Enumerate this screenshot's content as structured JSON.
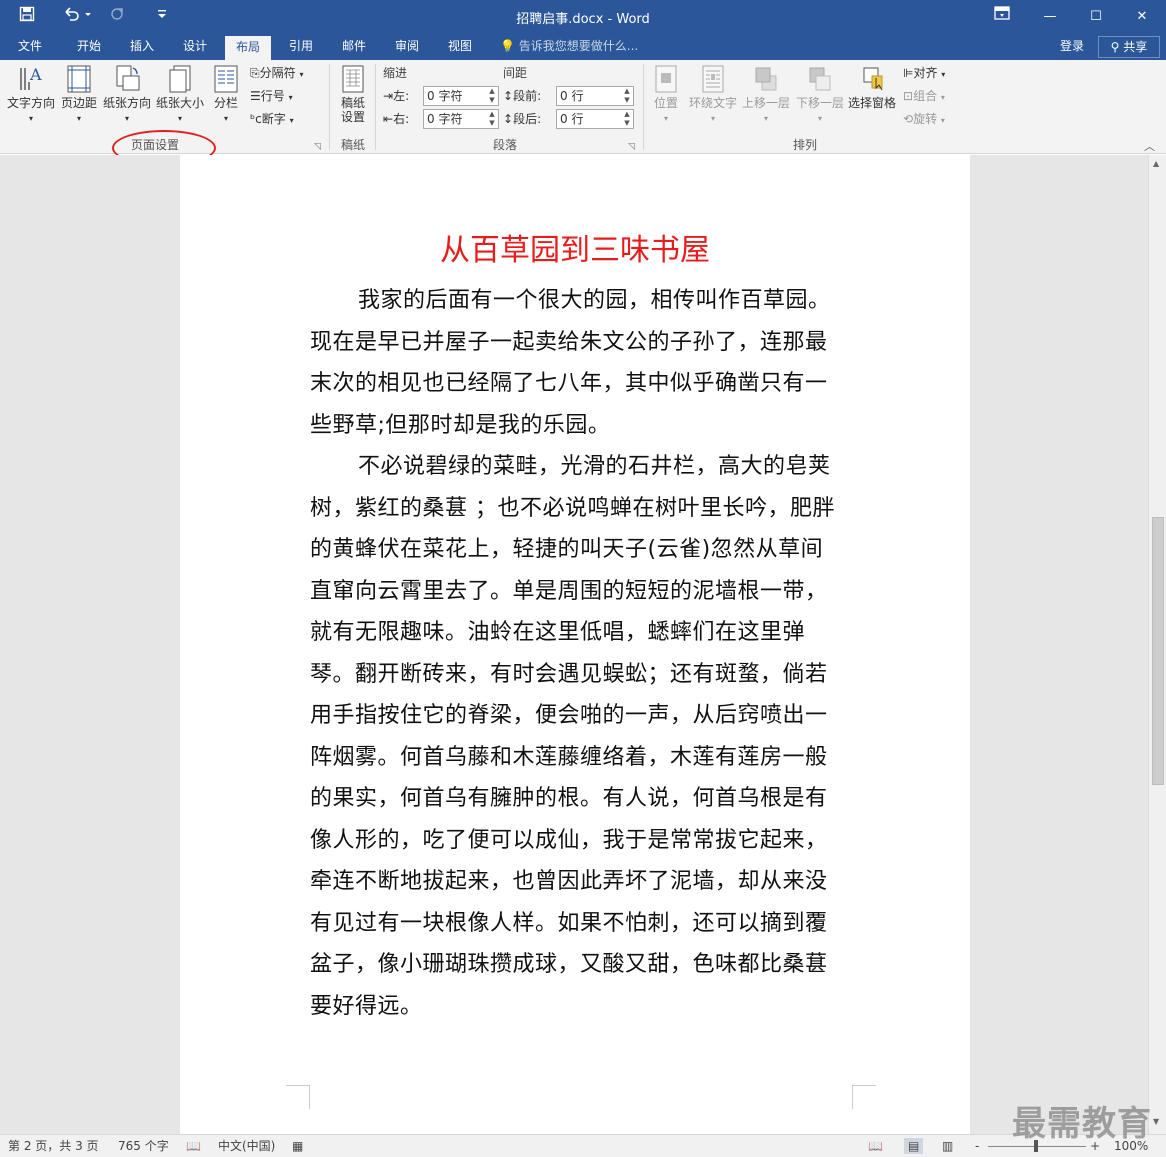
{
  "titlebar": {
    "doc_title": "招聘启事.docx - Word",
    "save_icon": "save-icon",
    "undo_icon": "undo-icon",
    "redo_icon": "redo-icon",
    "customize_icon": "customize-icon",
    "restore_ribbon_icon": "ribbon-display-icon",
    "minimize": "—",
    "maximize": "☐",
    "close": "✕"
  },
  "tabs": [
    "文件",
    "开始",
    "插入",
    "设计",
    "布局",
    "引用",
    "邮件",
    "审阅",
    "视图"
  ],
  "active_tab": "布局",
  "tell_me": "告诉我您想要做什么...",
  "login": "登录",
  "share": "共享",
  "ribbon": {
    "page_setup": {
      "text_direction": "文字方向",
      "margins": "页边距",
      "orientation": "纸张方向",
      "size": "纸张大小",
      "columns": "分栏",
      "breaks": "分隔符",
      "line_numbers": "行号",
      "hyphenation": "断字",
      "group_label": "页面设置"
    },
    "draft_paper": {
      "button_line1": "稿纸",
      "button_line2": "设置",
      "group_label": "稿纸"
    },
    "paragraph": {
      "indent_title": "缩进",
      "spacing_title": "间距",
      "left_label": "左:",
      "right_label": "右:",
      "left_value": "0 字符",
      "right_value": "0 字符",
      "before_label": "段前:",
      "after_label": "段后:",
      "before_value": "0 行",
      "after_value": "0 行",
      "group_label": "段落"
    },
    "arrange": {
      "position": "位置",
      "wrap_text": "环绕文字",
      "bring_forward": "上移一层",
      "send_backward": "下移一层",
      "selection_pane": "选择窗格",
      "align": "对齐",
      "group": "组合",
      "rotate": "旋转",
      "group_label": "排列"
    }
  },
  "document": {
    "heading": "从百草园到三味书屋",
    "paragraphs": [
      "我家的后面有一个很大的园，相传叫作百草园。现在是早已并屋子一起卖给朱文公的子孙了，连那最末次的相见也已经隔了七八年，其中似乎确凿只有一些野草;但那时却是我的乐园。",
      "不必说碧绿的菜畦，光滑的石井栏，高大的皂荚树，紫红的桑葚 ；也不必说鸣蝉在树叶里长吟，肥胖的黄蜂伏在菜花上，轻捷的叫天子(云雀)忽然从草间直窜向云霄里去了。单是周围的短短的泥墙根一带，就有无限趣味。油蛉在这里低唱，蟋蟀们在这里弹琴。翻开断砖来，有时会遇见蜈蚣；还有斑蝥，倘若用手指按住它的脊梁，便会啪的一声，从后窍喷出一阵烟雾。何首乌藤和木莲藤缠络着，木莲有莲房一般的果实，何首乌有臃肿的根。有人说，何首乌根是有像人形的，吃了便可以成仙，我于是常常拔它起来，牵连不断地拔起来，也曾因此弄坏了泥墙，却从来没有见过有一块根像人样。如果不怕刺，还可以摘到覆盆子，像小珊瑚珠攒成球，又酸又甜，色味都比桑葚要好得远。"
    ]
  },
  "status": {
    "page": "第 2 页，共 3 页",
    "words": "765 个字",
    "language": "中文(中国)",
    "zoom_minus": "-",
    "zoom_plus": "+",
    "zoom": "100%"
  },
  "watermark": "最需教育",
  "colors": {
    "accent": "#2b579a",
    "heading": "#e81c1c",
    "annotation": "#e02020"
  }
}
